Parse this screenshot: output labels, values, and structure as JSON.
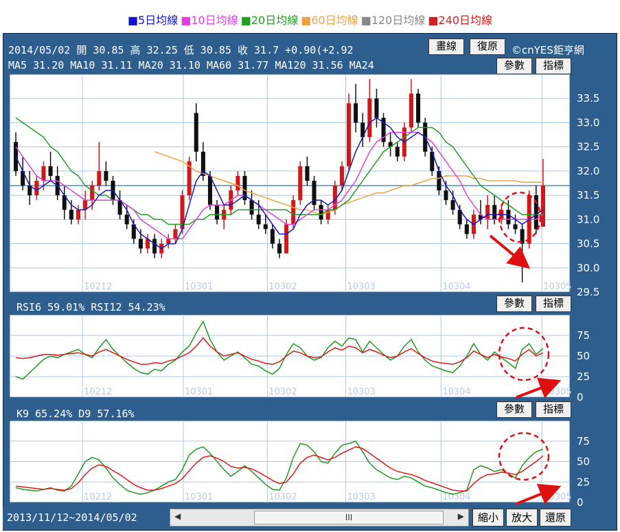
{
  "legend": [
    {
      "label": "5日均線",
      "color": "#1414c8"
    },
    {
      "label": "10日均線",
      "color": "#e040e0"
    },
    {
      "label": "20日均線",
      "color": "#20a020"
    },
    {
      "label": "60日均線",
      "color": "#f0a040"
    },
    {
      "label": "120日均線",
      "color": "#888888"
    },
    {
      "label": "240日均線",
      "color": "#d02020"
    }
  ],
  "header": {
    "quote": "2014/05/02 開 30.85 高 32.25 低 30.85 收 31.7 +0.90(+2.92",
    "ma_line": "MA5 31.20  MA10 31.11  MA20 31.10  MA60 31.77  MA120 31.56  MA24",
    "brand": "©cnYES鉅亨網"
  },
  "buttons": {
    "draw": "畫線",
    "reset": "復原",
    "params": "參數",
    "indicator": "指標",
    "zoom_out": "縮小",
    "zoom_in": "放大",
    "restore": "還原"
  },
  "range_text": "2013/11/12~2014/05/02",
  "scroll_grip": "III",
  "rsi_header": "RSI6 59.01%  RSI12 54.23%",
  "kd_header": "K9 65.24%  D9 57.16%",
  "months": [
    "10212",
    "10301",
    "10302",
    "10303",
    "10304",
    "10305"
  ],
  "chart_data": [
    {
      "type": "candlestick",
      "ylim": [
        29.5,
        34.0
      ],
      "yticks": [
        "33.5",
        "33.0",
        "32.5",
        "32.0",
        "31.5",
        "31.0",
        "30.5",
        "30.0",
        "29.5"
      ],
      "reference_price": 31.7,
      "ohlc": [
        [
          32.6,
          32.8,
          31.9,
          32.0
        ],
        [
          32.0,
          32.3,
          31.6,
          31.7
        ],
        [
          31.7,
          32.0,
          31.3,
          31.5
        ],
        [
          31.5,
          31.9,
          31.4,
          31.8
        ],
        [
          31.8,
          32.2,
          31.6,
          32.1
        ],
        [
          32.1,
          32.4,
          31.8,
          31.9
        ],
        [
          31.9,
          32.1,
          31.4,
          31.5
        ],
        [
          31.5,
          31.7,
          31.0,
          31.2
        ],
        [
          31.2,
          31.4,
          30.9,
          31.0
        ],
        [
          31.0,
          31.3,
          30.9,
          31.2
        ],
        [
          31.2,
          31.6,
          31.0,
          31.4
        ],
        [
          31.4,
          31.8,
          31.2,
          31.7
        ],
        [
          31.7,
          32.6,
          31.6,
          32.0
        ],
        [
          32.0,
          32.2,
          31.7,
          31.8
        ],
        [
          31.8,
          31.9,
          31.3,
          31.4
        ],
        [
          31.4,
          31.6,
          31.0,
          31.1
        ],
        [
          31.1,
          31.3,
          30.8,
          30.9
        ],
        [
          30.9,
          31.0,
          30.5,
          30.6
        ],
        [
          30.6,
          30.8,
          30.3,
          30.4
        ],
        [
          30.4,
          30.7,
          30.3,
          30.6
        ],
        [
          30.6,
          30.7,
          30.2,
          30.3
        ],
        [
          30.3,
          30.6,
          30.2,
          30.5
        ],
        [
          30.5,
          30.7,
          30.4,
          30.6
        ],
        [
          30.6,
          30.9,
          30.5,
          30.8
        ],
        [
          30.8,
          31.6,
          30.7,
          31.5
        ],
        [
          31.5,
          32.3,
          31.4,
          32.2
        ],
        [
          33.2,
          33.4,
          32.2,
          32.4
        ],
        [
          32.4,
          32.6,
          31.8,
          31.9
        ],
        [
          31.9,
          32.0,
          31.2,
          31.3
        ],
        [
          31.3,
          31.4,
          30.9,
          31.0
        ],
        [
          31.0,
          31.3,
          30.8,
          31.2
        ],
        [
          31.2,
          31.7,
          31.1,
          31.6
        ],
        [
          31.6,
          32.0,
          31.5,
          31.9
        ],
        [
          31.9,
          32.0,
          31.3,
          31.4
        ],
        [
          31.4,
          31.6,
          31.0,
          31.1
        ],
        [
          31.1,
          31.4,
          30.8,
          30.9
        ],
        [
          30.9,
          31.1,
          30.7,
          30.8
        ],
        [
          30.8,
          30.9,
          30.4,
          30.5
        ],
        [
          30.5,
          30.6,
          30.2,
          30.3
        ],
        [
          30.3,
          31.0,
          30.3,
          30.9
        ],
        [
          30.9,
          31.5,
          30.8,
          31.4
        ],
        [
          31.4,
          32.2,
          31.3,
          32.1
        ],
        [
          32.1,
          32.3,
          31.7,
          31.8
        ],
        [
          31.8,
          31.9,
          31.2,
          31.3
        ],
        [
          31.3,
          31.4,
          30.9,
          31.0
        ],
        [
          31.0,
          31.3,
          30.9,
          31.2
        ],
        [
          31.2,
          31.8,
          31.1,
          31.7
        ],
        [
          31.7,
          32.2,
          31.6,
          32.1
        ],
        [
          32.1,
          33.6,
          32.0,
          33.4
        ],
        [
          33.4,
          33.8,
          32.8,
          33.0
        ],
        [
          33.0,
          33.2,
          32.5,
          32.7
        ],
        [
          32.7,
          33.9,
          32.6,
          33.5
        ],
        [
          33.5,
          33.7,
          32.9,
          33.1
        ],
        [
          33.1,
          33.2,
          32.5,
          32.6
        ],
        [
          32.6,
          32.8,
          32.3,
          32.5
        ],
        [
          32.5,
          32.6,
          32.2,
          32.3
        ],
        [
          32.3,
          33.0,
          32.2,
          32.9
        ],
        [
          32.9,
          33.9,
          32.8,
          33.6
        ],
        [
          33.6,
          33.7,
          32.9,
          33.0
        ],
        [
          33.0,
          33.1,
          32.3,
          32.4
        ],
        [
          32.4,
          32.5,
          31.9,
          32.0
        ],
        [
          32.0,
          32.1,
          31.5,
          31.6
        ],
        [
          31.6,
          31.8,
          31.3,
          31.4
        ],
        [
          31.4,
          31.6,
          31.1,
          31.2
        ],
        [
          31.2,
          31.3,
          30.8,
          30.9
        ],
        [
          30.9,
          31.0,
          30.6,
          30.7
        ],
        [
          30.7,
          31.2,
          30.6,
          31.1
        ],
        [
          31.1,
          31.4,
          30.9,
          31.0
        ],
        [
          31.0,
          31.5,
          30.8,
          31.3
        ],
        [
          31.3,
          31.5,
          30.9,
          31.0
        ],
        [
          31.0,
          31.3,
          30.9,
          31.2
        ],
        [
          31.2,
          31.4,
          30.8,
          30.9
        ],
        [
          30.9,
          31.1,
          30.7,
          30.8
        ],
        [
          30.8,
          30.9,
          29.7,
          30.5
        ],
        [
          30.5,
          31.6,
          30.4,
          31.5
        ],
        [
          31.5,
          31.7,
          30.7,
          30.8
        ],
        [
          30.85,
          32.25,
          30.85,
          31.7
        ]
      ],
      "ma5": [
        32.3,
        32.0,
        31.7,
        31.6,
        31.7,
        31.8,
        31.7,
        31.5,
        31.3,
        31.2,
        31.2,
        31.3,
        31.5,
        31.6,
        31.6,
        31.4,
        31.2,
        30.9,
        30.7,
        30.6,
        30.5,
        30.4,
        30.5,
        30.5,
        30.8,
        31.3,
        31.8,
        32.0,
        31.9,
        31.6,
        31.3,
        31.3,
        31.4,
        31.5,
        31.4,
        31.3,
        31.1,
        30.9,
        30.7,
        30.7,
        30.8,
        31.1,
        31.3,
        31.4,
        31.4,
        31.3,
        31.4,
        31.6,
        32.0,
        32.4,
        32.7,
        33.0,
        33.1,
        33.0,
        32.9,
        32.7,
        32.6,
        32.7,
        32.8,
        32.7,
        32.4,
        32.0,
        31.7,
        31.5,
        31.2,
        31.0,
        30.9,
        31.0,
        31.1,
        31.1,
        31.1,
        31.1,
        31.0,
        30.9,
        31.0,
        31.1,
        31.2
      ],
      "ma10": [
        32.5,
        32.3,
        32.1,
        31.9,
        31.8,
        31.8,
        31.8,
        31.7,
        31.6,
        31.5,
        31.4,
        31.4,
        31.4,
        31.4,
        31.4,
        31.4,
        31.3,
        31.2,
        31.0,
        30.9,
        30.8,
        30.7,
        30.6,
        30.6,
        30.6,
        30.8,
        31.0,
        31.2,
        31.3,
        31.3,
        31.3,
        31.4,
        31.5,
        31.5,
        31.4,
        31.3,
        31.2,
        31.1,
        31.0,
        30.9,
        30.9,
        31.0,
        31.1,
        31.2,
        31.2,
        31.2,
        31.3,
        31.4,
        31.6,
        31.8,
        32.1,
        32.4,
        32.6,
        32.7,
        32.8,
        32.8,
        32.8,
        32.8,
        32.8,
        32.7,
        32.6,
        32.4,
        32.2,
        32.0,
        31.8,
        31.5,
        31.3,
        31.1,
        31.0,
        31.0,
        31.0,
        31.0,
        31.0,
        31.0,
        31.0,
        31.0,
        31.1
      ],
      "ma20": [
        33.1,
        33.0,
        32.9,
        32.8,
        32.7,
        32.5,
        32.4,
        32.2,
        32.0,
        31.9,
        31.7,
        31.6,
        31.5,
        31.5,
        31.4,
        31.4,
        31.3,
        31.2,
        31.1,
        31.1,
        31.0,
        31.0,
        30.9,
        30.9,
        30.9,
        30.9,
        31.0,
        31.0,
        31.1,
        31.1,
        31.1,
        31.1,
        31.2,
        31.2,
        31.2,
        31.2,
        31.2,
        31.2,
        31.2,
        31.2,
        31.1,
        31.1,
        31.1,
        31.1,
        31.1,
        31.2,
        31.2,
        31.3,
        31.4,
        31.6,
        31.8,
        32.0,
        32.2,
        32.4,
        32.5,
        32.6,
        32.7,
        32.8,
        32.9,
        32.9,
        32.9,
        32.8,
        32.6,
        32.5,
        32.3,
        32.1,
        31.9,
        31.7,
        31.6,
        31.5,
        31.4,
        31.3,
        31.2,
        31.1,
        31.1,
        31.1,
        31.1
      ],
      "ma60": [
        null,
        null,
        null,
        null,
        null,
        null,
        null,
        null,
        null,
        null,
        null,
        null,
        null,
        null,
        null,
        null,
        null,
        null,
        null,
        null,
        32.4,
        32.35,
        32.3,
        32.25,
        32.2,
        32.1,
        32.0,
        31.95,
        31.9,
        31.85,
        31.8,
        31.75,
        31.7,
        31.6,
        31.55,
        31.5,
        31.45,
        31.4,
        31.35,
        31.3,
        31.25,
        31.2,
        31.2,
        31.15,
        31.1,
        31.15,
        31.2,
        31.3,
        31.35,
        31.4,
        31.45,
        31.5,
        31.55,
        31.55,
        31.6,
        31.65,
        31.7,
        31.7,
        31.75,
        31.8,
        31.85,
        31.85,
        31.9,
        31.9,
        31.9,
        31.9,
        31.85,
        31.85,
        31.8,
        31.8,
        31.8,
        31.8,
        31.8,
        31.77,
        31.77,
        31.77,
        31.77
      ]
    },
    {
      "type": "line",
      "ylim": [
        0,
        100
      ],
      "yticks": [
        "75",
        "50",
        "25",
        "0"
      ],
      "series": [
        {
          "name": "RSI6",
          "color": "#1e9a1e",
          "values": [
            25,
            22,
            30,
            38,
            46,
            50,
            48,
            52,
            55,
            58,
            52,
            48,
            60,
            70,
            58,
            50,
            42,
            35,
            30,
            28,
            34,
            32,
            40,
            45,
            55,
            62,
            78,
            92,
            70,
            55,
            45,
            50,
            55,
            48,
            40,
            38,
            32,
            28,
            35,
            52,
            65,
            60,
            50,
            45,
            48,
            60,
            68,
            62,
            72,
            70,
            55,
            68,
            60,
            52,
            45,
            50,
            62,
            70,
            55,
            45,
            38,
            35,
            32,
            30,
            38,
            50,
            65,
            52,
            45,
            55,
            48,
            42,
            35,
            58,
            65,
            52,
            59
          ]
        },
        {
          "name": "RSI12",
          "color": "#e01818",
          "values": [
            48,
            47,
            48,
            50,
            52,
            52,
            51,
            52,
            53,
            54,
            52,
            50,
            55,
            58,
            54,
            50,
            46,
            43,
            40,
            40,
            42,
            41,
            44,
            46,
            50,
            54,
            62,
            72,
            62,
            55,
            50,
            52,
            54,
            50,
            46,
            44,
            41,
            40,
            43,
            50,
            56,
            54,
            50,
            48,
            49,
            55,
            60,
            57,
            62,
            60,
            54,
            58,
            55,
            51,
            48,
            50,
            55,
            59,
            53,
            48,
            44,
            42,
            41,
            40,
            43,
            48,
            56,
            52,
            48,
            52,
            49,
            47,
            44,
            52,
            58,
            50,
            54
          ]
        }
      ]
    },
    {
      "type": "line",
      "ylim": [
        0,
        100
      ],
      "yticks": [
        "75",
        "50",
        "25",
        "0"
      ],
      "series": [
        {
          "name": "K9",
          "color": "#1e9a1e",
          "values": [
            18,
            16,
            15,
            14,
            16,
            18,
            15,
            14,
            20,
            35,
            50,
            55,
            52,
            42,
            30,
            22,
            15,
            12,
            10,
            12,
            15,
            20,
            25,
            28,
            40,
            58,
            65,
            68,
            60,
            50,
            40,
            32,
            38,
            45,
            38,
            30,
            22,
            16,
            15,
            30,
            55,
            72,
            70,
            62,
            50,
            48,
            60,
            70,
            72,
            75,
            62,
            48,
            40,
            35,
            30,
            28,
            32,
            30,
            25,
            20,
            18,
            15,
            12,
            10,
            12,
            15,
            40,
            45,
            42,
            38,
            40,
            35,
            30,
            45,
            55,
            62,
            65
          ]
        },
        {
          "name": "D9",
          "color": "#e01818",
          "values": [
            20,
            19,
            18,
            17,
            16,
            17,
            16,
            15,
            17,
            24,
            34,
            42,
            46,
            44,
            39,
            34,
            28,
            22,
            18,
            15,
            15,
            17,
            20,
            23,
            29,
            39,
            48,
            55,
            57,
            54,
            50,
            44,
            42,
            43,
            41,
            37,
            32,
            27,
            23,
            25,
            35,
            48,
            55,
            58,
            55,
            52,
            55,
            60,
            64,
            68,
            66,
            60,
            54,
            48,
            42,
            38,
            36,
            34,
            31,
            27,
            24,
            21,
            18,
            15,
            14,
            14,
            23,
            30,
            34,
            35,
            37,
            36,
            34,
            38,
            44,
            50,
            57
          ]
        }
      ]
    }
  ]
}
